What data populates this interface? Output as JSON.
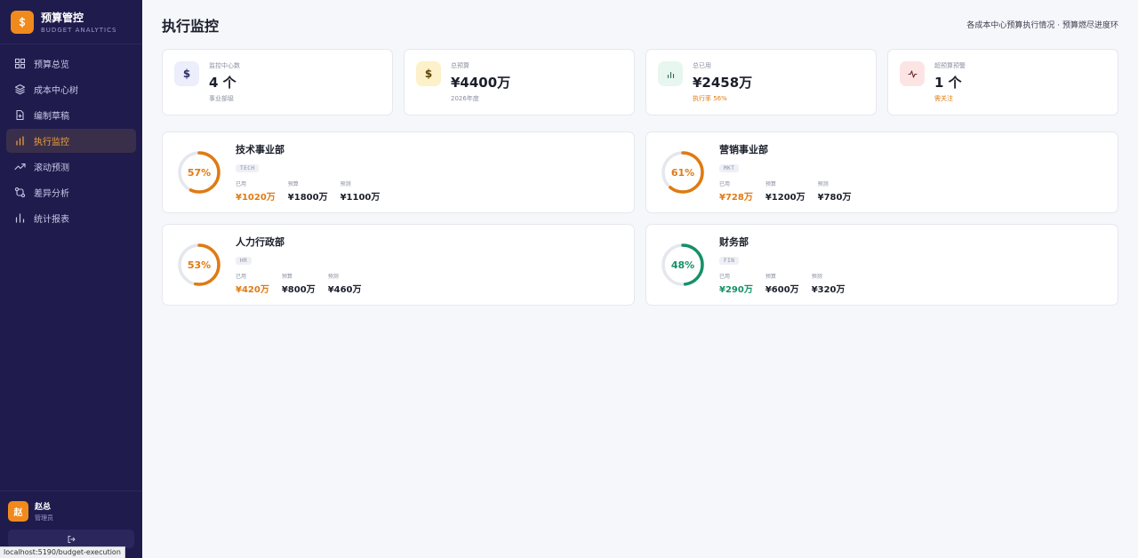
{
  "brand": {
    "title": "预算管控",
    "subtitle": "BUDGET ANALYTICS",
    "logo_icon": "dollar-icon"
  },
  "nav": [
    {
      "label": "预算总览",
      "icon": "grid-icon",
      "active": false
    },
    {
      "label": "成本中心树",
      "icon": "layers-icon",
      "active": false
    },
    {
      "label": "编制草稿",
      "icon": "file-plus-icon",
      "active": false
    },
    {
      "label": "执行监控",
      "icon": "bar-chart-icon",
      "active": true
    },
    {
      "label": "滚动预测",
      "icon": "trending-up-icon",
      "active": false
    },
    {
      "label": "差异分析",
      "icon": "git-compare-icon",
      "active": false
    },
    {
      "label": "统计报表",
      "icon": "stats-icon",
      "active": false
    }
  ],
  "user": {
    "avatar": "赵",
    "name": "赵总",
    "role": "管理员",
    "logout_icon": "logout-icon"
  },
  "status_url": "localhost:5190/budget-execution",
  "header": {
    "title": "执行监控",
    "subtitle": "各成本中心预算执行情况 · 预算燃尽进度环"
  },
  "stats": [
    {
      "label": "监控中心数",
      "value": "4 个",
      "note": "事业部级",
      "icon": "dollar-icon",
      "note_color": "#8b90a0"
    },
    {
      "label": "总预算",
      "value": "¥4400万",
      "note": "2026年度",
      "icon": "dollar-icon",
      "note_color": "#8b90a0"
    },
    {
      "label": "总已用",
      "value": "¥2458万",
      "note": "执行率 56%",
      "icon": "bar-chart-icon",
      "note_color": "#e07a12"
    },
    {
      "label": "超预算预警",
      "value": "1 个",
      "note": "需关注",
      "icon": "activity-icon",
      "note_color": "#e07a12"
    }
  ],
  "labels": {
    "used": "已用",
    "budget": "预算",
    "forecast": "预测"
  },
  "departments": [
    {
      "name": "技术事业部",
      "code": "TECH",
      "percent": "57%",
      "ratio": 0.57,
      "color": "#e07a12",
      "used": "¥1020万",
      "budget": "¥1800万",
      "forecast": "¥1100万"
    },
    {
      "name": "营销事业部",
      "code": "MKT",
      "percent": "61%",
      "ratio": 0.61,
      "color": "#e07a12",
      "used": "¥728万",
      "budget": "¥1200万",
      "forecast": "¥780万"
    },
    {
      "name": "人力行政部",
      "code": "HR",
      "percent": "53%",
      "ratio": 0.53,
      "color": "#e07a12",
      "used": "¥420万",
      "budget": "¥800万",
      "forecast": "¥460万"
    },
    {
      "name": "财务部",
      "code": "FIN",
      "percent": "48%",
      "ratio": 0.48,
      "color": "#169068",
      "used": "¥290万",
      "budget": "¥600万",
      "forecast": "¥320万"
    }
  ]
}
